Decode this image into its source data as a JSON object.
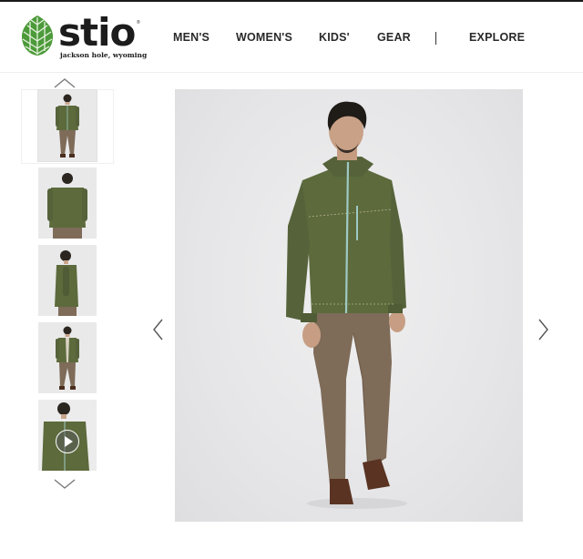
{
  "brand": {
    "name": "stio",
    "tagline": "jackson hole, wyoming",
    "trademark": "®",
    "accent_color": "#4c9a3a"
  },
  "nav": {
    "items": [
      {
        "label": "MEN'S"
      },
      {
        "label": "WOMEN'S"
      },
      {
        "label": "KIDS'"
      },
      {
        "label": "GEAR"
      },
      {
        "label": "EXPLORE"
      }
    ]
  },
  "gallery": {
    "thumbnails": [
      {
        "view": "front-full",
        "active": true
      },
      {
        "view": "back"
      },
      {
        "view": "side"
      },
      {
        "view": "front-open"
      },
      {
        "view": "video",
        "icon": "play-icon"
      }
    ],
    "icons": {
      "up": "chevron-up-icon",
      "down": "chevron-down-icon",
      "prev": "chevron-left-icon",
      "next": "chevron-right-icon"
    }
  },
  "product": {
    "jacket_color": "#5c6a3c",
    "pants_color": "#7e6b58",
    "boots_color": "#5a3322",
    "zip_color": "#9fc9c4"
  }
}
